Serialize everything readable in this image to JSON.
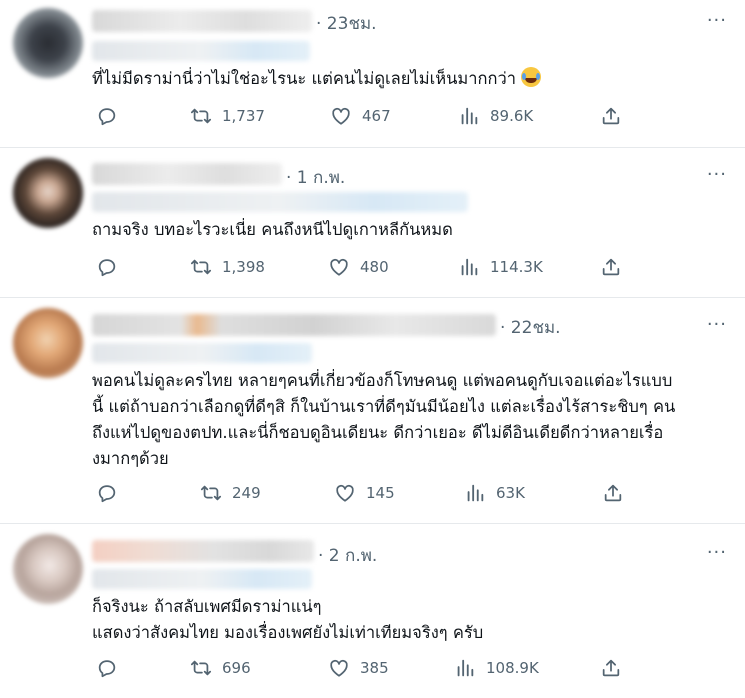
{
  "tweets": [
    {
      "time": "· 23ชม.",
      "more": "···",
      "lines": [
        "ที่ไม่มีดราม่านี่ว่าไม่ใช่อะไรนะ  แต่คนไม่ดูเลยไม่เห็นมากกว่า"
      ],
      "emoji": "face-with-tears-of-joy",
      "replies": "",
      "retweets": "1,737",
      "likes": "467",
      "views": "89.6K"
    },
    {
      "time": "· 1 ก.พ.",
      "more": "···",
      "lines": [
        "ถามจริง บทอะไรวะเนี่ย คนถึงหนีไปดูเกาหลีกันหมด"
      ],
      "replies": "",
      "retweets": "1,398",
      "likes": "480",
      "views": "114.3K"
    },
    {
      "time": "· 22ชม.",
      "more": "···",
      "lines": [
        "พอคนไม่ดูละครไทย หลายๆคนที่เกี่ยวข้องก็โทษคนดู แต่พอคนดูกับเจอแต่อะไรแบบ",
        "นี้ แต่ถ้าบอกว่าเลือกดูที่ดีๆสิ ก็ในบ้านเราที่ดีๆมันมีน้อยไง แต่ละเรื่องไร้สาระชิบๆ คน",
        "ถึงแห่ไปดูของตปท.และนี่ก็ชอบดูอินเดียนะ ดีกว่าเยอะ ดีไม่ดีอินเดียดีกว่าหลายเรื่อ",
        "งมากๆด้วย"
      ],
      "replies": "",
      "retweets": "249",
      "likes": "145",
      "views": "63K"
    },
    {
      "time": "· 2 ก.พ.",
      "more": "···",
      "lines": [
        "ก็จริงนะ ถ้าสลับเพศมีดราม่าแน่ๆ",
        "แสดงว่าสังคมไทย มองเรื่องเพศยังไม่เท่าเทียมจริงๆ ครับ"
      ],
      "replies": "",
      "retweets": "696",
      "likes": "385",
      "views": "108.9K"
    }
  ],
  "icons": [
    "reply-icon",
    "retweet-icon",
    "like-icon",
    "views-icon",
    "share-icon"
  ],
  "colors": {
    "text": "#0f1419",
    "muted": "#536471",
    "divider": "#e6e9ec"
  }
}
